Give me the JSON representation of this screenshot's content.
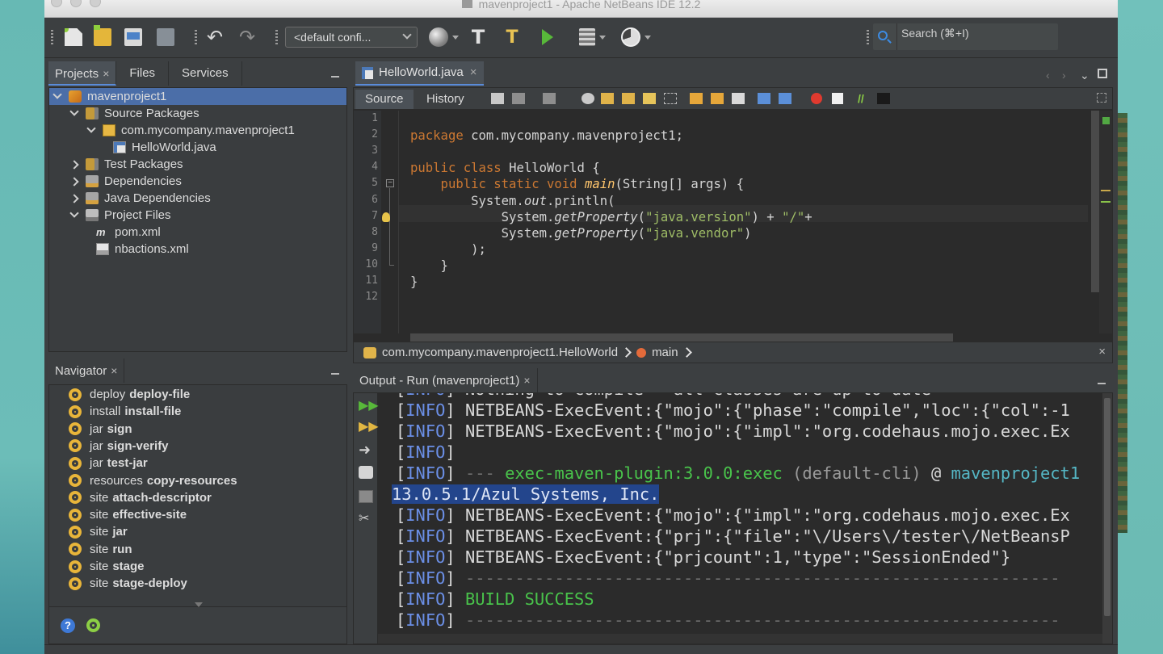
{
  "window": {
    "title": "mavenproject1 - Apache NetBeans IDE 12.2"
  },
  "toolbar": {
    "config_combo": "<default confi...",
    "search_placeholder": "Search (⌘+I)"
  },
  "icons": [
    "new-file-icon",
    "new-project-icon",
    "open-project-icon",
    "save-all-icon",
    "undo-icon",
    "redo-icon",
    "globe-icon",
    "build-hammer-icon",
    "clean-build-icon",
    "run-icon",
    "debug-icon",
    "profile-icon",
    "search-icon",
    "gear-icon",
    "help-icon"
  ],
  "left_tabs": [
    {
      "label": "Projects",
      "close": "×"
    },
    {
      "label": "Files"
    },
    {
      "label": "Services"
    }
  ],
  "project_tree": [
    {
      "label": "mavenproject1",
      "level": 0,
      "expanded": true,
      "selected": true,
      "icon": "maven-project-icon"
    },
    {
      "label": "Source Packages",
      "level": 1,
      "expanded": true,
      "icon": "source-packages-icon"
    },
    {
      "label": "com.mycompany.mavenproject1",
      "level": 2,
      "expanded": true,
      "icon": "package-icon"
    },
    {
      "label": "HelloWorld.java",
      "level": 3,
      "icon": "java-file-icon"
    },
    {
      "label": "Test Packages",
      "level": 1,
      "expanded": false,
      "icon": "test-packages-icon"
    },
    {
      "label": "Dependencies",
      "level": 1,
      "expanded": false,
      "icon": "dependencies-icon"
    },
    {
      "label": "Java Dependencies",
      "level": 1,
      "expanded": false,
      "icon": "java-dependencies-icon"
    },
    {
      "label": "Project Files",
      "level": 1,
      "expanded": true,
      "icon": "project-files-icon"
    },
    {
      "label": "pom.xml",
      "level": 2,
      "icon": "pom-file-icon"
    },
    {
      "label": "nbactions.xml",
      "level": 2,
      "icon": "xml-file-icon"
    }
  ],
  "navigator": {
    "tab": "Navigator",
    "items": [
      {
        "prefix": "deploy",
        "goal": "deploy-file"
      },
      {
        "prefix": "install",
        "goal": "install-file"
      },
      {
        "prefix": "jar",
        "goal": "sign"
      },
      {
        "prefix": "jar",
        "goal": "sign-verify"
      },
      {
        "prefix": "jar",
        "goal": "test-jar"
      },
      {
        "prefix": "resources",
        "goal": "copy-resources"
      },
      {
        "prefix": "site",
        "goal": "attach-descriptor"
      },
      {
        "prefix": "site",
        "goal": "effective-site"
      },
      {
        "prefix": "site",
        "goal": "jar"
      },
      {
        "prefix": "site",
        "goal": "run"
      },
      {
        "prefix": "site",
        "goal": "stage"
      },
      {
        "prefix": "site",
        "goal": "stage-deploy"
      }
    ]
  },
  "editor": {
    "tab": "HelloWorld.java",
    "source_tab": "Source",
    "history_tab": "History",
    "line_numbers": [
      "1",
      "2",
      "3",
      "4",
      "5",
      "6",
      "7",
      "8",
      "9",
      "10",
      "11",
      "12"
    ],
    "breadcrumb_class": "com.mycompany.mavenproject1.HelloWorld",
    "breadcrumb_method": "main"
  },
  "code_lines": [
    [],
    [
      {
        "t": "package ",
        "c": "kw"
      },
      {
        "t": "com.mycompany.mavenproject1;",
        "c": ""
      }
    ],
    [],
    [
      {
        "t": "public class ",
        "c": "kw"
      },
      {
        "t": "HelloWorld {",
        "c": ""
      }
    ],
    [
      {
        "t": "    public static void ",
        "c": "kw"
      },
      {
        "t": "main",
        "c": "fnc"
      },
      {
        "t": "(String[] args) {",
        "c": ""
      }
    ],
    [
      {
        "t": "        System.",
        "c": ""
      },
      {
        "t": "out",
        "c": "ital"
      },
      {
        "t": ".println(",
        "c": ""
      }
    ],
    [
      {
        "t": "            System.",
        "c": ""
      },
      {
        "t": "getProperty",
        "c": "ital"
      },
      {
        "t": "(",
        "c": ""
      },
      {
        "t": "\"java.version\"",
        "c": "str"
      },
      {
        "t": ") + ",
        "c": ""
      },
      {
        "t": "\"/\"",
        "c": "str"
      },
      {
        "t": "+",
        "c": ""
      }
    ],
    [
      {
        "t": "            System.",
        "c": ""
      },
      {
        "t": "getProperty",
        "c": "ital"
      },
      {
        "t": "(",
        "c": ""
      },
      {
        "t": "\"java.vendor\"",
        "c": "str"
      },
      {
        "t": ")",
        "c": ""
      }
    ],
    [
      {
        "t": "        );",
        "c": ""
      }
    ],
    [
      {
        "t": "    }",
        "c": ""
      }
    ],
    [
      {
        "t": "}",
        "c": ""
      }
    ],
    []
  ],
  "output": {
    "tab": "Output - Run (mavenproject1)",
    "lines": [
      [
        {
          "t": "[",
          "c": "br"
        },
        {
          "t": "INFO",
          "c": "info"
        },
        {
          "t": "] Nothing to compile - all classes are up to date",
          "c": ""
        }
      ],
      [
        {
          "t": "[",
          "c": "br"
        },
        {
          "t": "INFO",
          "c": "info"
        },
        {
          "t": "] NETBEANS-ExecEvent:{\"mojo\":{\"phase\":\"compile\",\"loc\":{\"col\":-1",
          "c": ""
        }
      ],
      [
        {
          "t": "[",
          "c": "br"
        },
        {
          "t": "INFO",
          "c": "info"
        },
        {
          "t": "] NETBEANS-ExecEvent:{\"mojo\":{\"impl\":\"org.codehaus.mojo.exec.Ex",
          "c": ""
        }
      ],
      [
        {
          "t": "[",
          "c": "br"
        },
        {
          "t": "INFO",
          "c": "info"
        },
        {
          "t": "]",
          "c": ""
        }
      ],
      [
        {
          "t": "[",
          "c": "br"
        },
        {
          "t": "INFO",
          "c": "info"
        },
        {
          "t": "] ",
          "c": ""
        },
        {
          "t": "--- ",
          "c": "dash"
        },
        {
          "t": "exec-maven-plugin:3.0.0:exec",
          "c": "green"
        },
        {
          "t": " (default-cli)",
          "c": "gray"
        },
        {
          "t": " @ ",
          "c": ""
        },
        {
          "t": "mavenproject1",
          "c": "teal"
        }
      ],
      [
        {
          "t": "13.0.5.1/Azul Systems, Inc.",
          "c": "hl"
        }
      ],
      [
        {
          "t": "[",
          "c": "br"
        },
        {
          "t": "INFO",
          "c": "info"
        },
        {
          "t": "] NETBEANS-ExecEvent:{\"mojo\":{\"impl\":\"org.codehaus.mojo.exec.Ex",
          "c": ""
        }
      ],
      [
        {
          "t": "[",
          "c": "br"
        },
        {
          "t": "INFO",
          "c": "info"
        },
        {
          "t": "] NETBEANS-ExecEvent:{\"prj\":{\"file\":\"\\/Users\\/tester\\/NetBeansP",
          "c": ""
        }
      ],
      [
        {
          "t": "[",
          "c": "br"
        },
        {
          "t": "INFO",
          "c": "info"
        },
        {
          "t": "] NETBEANS-ExecEvent:{\"prjcount\":1,\"type\":\"SessionEnded\"}",
          "c": ""
        }
      ],
      [
        {
          "t": "[",
          "c": "br"
        },
        {
          "t": "INFO",
          "c": "info"
        },
        {
          "t": "] ",
          "c": ""
        },
        {
          "t": "------------------------------------------------------------",
          "c": "dash"
        }
      ],
      [
        {
          "t": "[",
          "c": "br"
        },
        {
          "t": "INFO",
          "c": "info"
        },
        {
          "t": "] ",
          "c": ""
        },
        {
          "t": "BUILD SUCCESS",
          "c": "green"
        }
      ],
      [
        {
          "t": "[",
          "c": "br"
        },
        {
          "t": "INFO",
          "c": "info"
        },
        {
          "t": "] ",
          "c": ""
        },
        {
          "t": "------------------------------------------------------------",
          "c": "dash"
        }
      ]
    ]
  }
}
